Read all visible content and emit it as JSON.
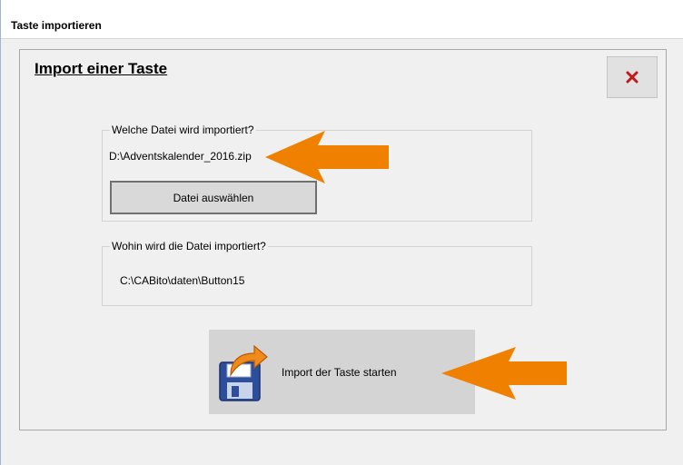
{
  "window": {
    "title": "Taste importieren"
  },
  "dialog": {
    "heading": "Import einer Taste",
    "close_icon": "close-x-icon",
    "source_group": {
      "legend": "Welche Datei wird importiert?",
      "file_path": "D:\\Adventskalender_2016.zip",
      "select_button_label": "Datei auswählen"
    },
    "target_group": {
      "legend": "Wohin wird die Datei importiert?",
      "target_path": "C:\\CABito\\daten\\Button15"
    },
    "start_button": {
      "label": "Import der Taste starten",
      "icon": "floppy-disk-export-icon"
    }
  },
  "colors": {
    "arrow": "#f08000",
    "close_x": "#c0191a",
    "button_face": "#d4d4d4"
  },
  "annotations": [
    {
      "name": "arrow-pointing-to-file-path",
      "direction": "left"
    },
    {
      "name": "arrow-pointing-to-start-button",
      "direction": "left"
    }
  ]
}
